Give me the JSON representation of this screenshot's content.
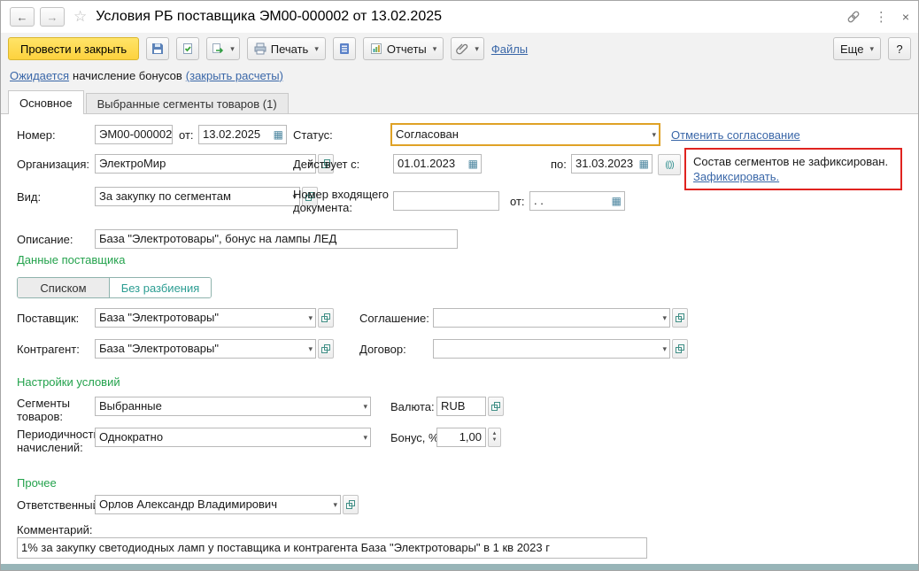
{
  "window": {
    "title": "Условия РБ поставщика ЭМ00-000002 от 13.02.2025"
  },
  "icons": {
    "back": "←",
    "forward": "→",
    "star": "☆",
    "menu": "⋮",
    "close": "×",
    "dropdown": "▾",
    "calendar": "▦",
    "history": "(())",
    "help": "?",
    "spin_up": "▲",
    "spin_down": "▼"
  },
  "toolbar": {
    "post_and_close": "Провести и закрыть",
    "print": "Печать",
    "reports": "Отчеты",
    "files": "Файлы",
    "more": "Еще"
  },
  "notice": {
    "pending_link": "Ожидается",
    "text": "начисление бонусов",
    "close_calc_link": "(закрыть расчеты)"
  },
  "tabs": [
    {
      "label": "Основное"
    },
    {
      "label": "Выбранные сегменты товаров (1)"
    }
  ],
  "main": {
    "number_label": "Номер:",
    "number_value": "ЭМ00-000002",
    "number_date_label": "от:",
    "number_date_value": "13.02.2025",
    "status_label": "Статус:",
    "status_value": "Согласован",
    "cancel_approval_link": "Отменить согласование",
    "organization_label": "Организация:",
    "organization_value": "ЭлектроМир",
    "valid_from_label": "Действует с:",
    "valid_from_value": "01.01.2023",
    "valid_to_label": "по:",
    "valid_to_value": "31.03.2023",
    "alert_text": "Состав сегментов не зафиксирован.",
    "alert_link": "Зафиксировать.",
    "kind_label": "Вид:",
    "kind_value": "За закупку по сегментам",
    "incoming_label": "Номер входящего документа:",
    "incoming_value": "",
    "incoming_date_label": "от:",
    "incoming_date_value": ". .",
    "description_label": "Описание:",
    "description_value": "База \"Электротовары\", бонус на лампы ЛЕД"
  },
  "supplier_section": {
    "title": "Данные поставщика",
    "toggle_list": "Списком",
    "toggle_no_split": "Без разбиения",
    "supplier_label": "Поставщик:",
    "supplier_value": "База \"Электротовары\"",
    "agreement_label": "Соглашение:",
    "agreement_value": "",
    "counterparty_label": "Контрагент:",
    "counterparty_value": "База \"Электротовары\"",
    "contract_label": "Договор:",
    "contract_value": ""
  },
  "settings_section": {
    "title": "Настройки условий",
    "segments_label": "Сегменты товаров:",
    "segments_value": "Выбранные",
    "currency_label": "Валюта:",
    "currency_value": "RUB",
    "periodicity_label": "Периодичность начислений:",
    "periodicity_value": "Однократно",
    "bonus_label": "Бонус, %:",
    "bonus_value": "1,00"
  },
  "other_section": {
    "title": "Прочее",
    "responsible_label": "Ответственный:",
    "responsible_value": "Орлов Александр Владимирович",
    "comment_label": "Комментарий:",
    "comment_value": "1% за закупку светодиодных ламп у поставщика и контрагента База \"Электротовары\" в 1 кв 2023 г"
  },
  "colors": {
    "accent_yellow": "#ffd84a",
    "status_border": "#dfa226",
    "alert_red": "#e0231f",
    "section_green": "#23a24c",
    "link_blue": "#3a67a8",
    "toggle_teal": "#2b9d92",
    "bottom_strip": "#98b5b8"
  }
}
